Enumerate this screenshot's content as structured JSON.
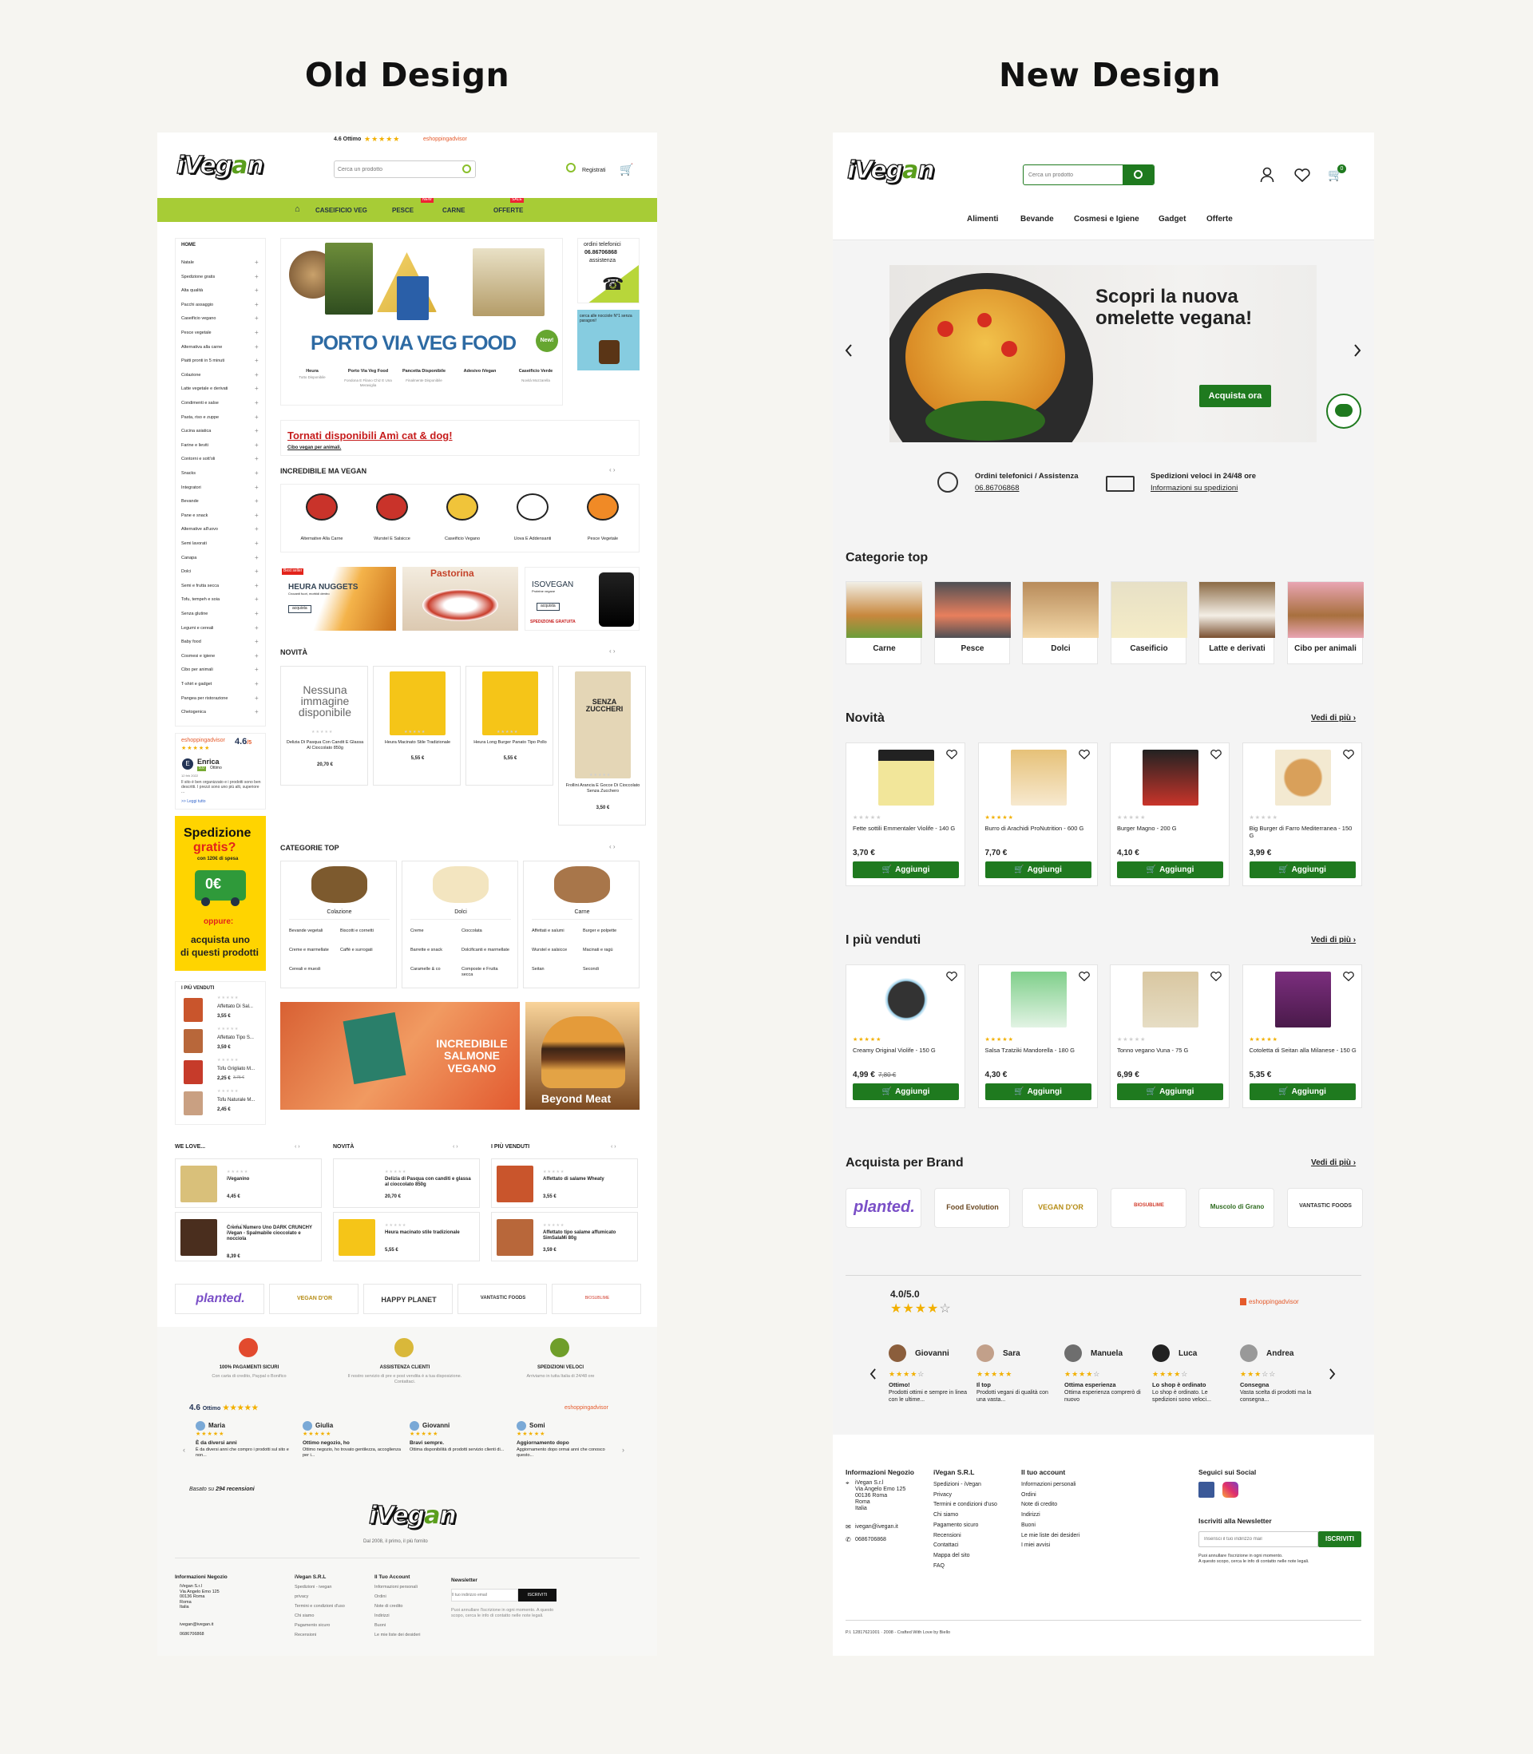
{
  "headings": {
    "old": "Old Design",
    "new": "New Design"
  },
  "old": {
    "topbar": {
      "score": "4.6 Ottimo",
      "advisor": "eshoppingadvisor"
    },
    "logo": {
      "pre": "iVeg",
      "mid": "a",
      "post": "n"
    },
    "search": {
      "placeholder": "Cerca un prodotto"
    },
    "register": "Registrati",
    "nav": {
      "items": [
        "CASEIFICIO VEG",
        "PESCE",
        "CARNE",
        "OFFERTE"
      ],
      "badges": [
        "NEW",
        "SALE"
      ]
    },
    "sidebar": {
      "home": "HOME",
      "items": [
        "Natale",
        "Spedizione gratis",
        "Alta qualità",
        "Pacchi assaggio",
        "Caseificio vegano",
        "Pesce vegetale",
        "Alternativa alla carne",
        "Piatti pronti in 5 minuti",
        "Colazione",
        "Latte vegetale e derivati",
        "Condimenti e salse",
        "Pasta, riso e zuppe",
        "Cucina asiatica",
        "Farine e lieviti",
        "Contorni e sott'oli",
        "Snacks",
        "Integratori",
        "Bevande",
        "Pane e snack",
        "Alternative all'uovo",
        "Semi lavorati",
        "Canapa",
        "Dolci",
        "Semi e frutta secca",
        "Tofu, tempeh e soia",
        "Senza glutine",
        "Legumi e cereali",
        "Baby food",
        "Cosmesi e igiene",
        "Cibo per animali",
        "T-shirt e gadget",
        "Pangea per ristorazione",
        "Chetogenica"
      ]
    },
    "sidereview": {
      "brand": "eshoppingadvisor",
      "score": "4.6",
      "outof": "/5",
      "name": "Enrica",
      "rating": "5.0",
      "label": "Ottimo",
      "date": "12 feb 2022",
      "text": "Il sito è ben organizzato e i prodotti sono ben descritti. I prezzi sono uno più alti, superiore ...",
      "more": ">> Leggi tutto"
    },
    "promo": {
      "title1": "Spedizione",
      "title2": "gratis?",
      "sub": "con 120€ di spesa",
      "price": "0€",
      "or": "oppure:",
      "cta1": "acquista uno",
      "cta2": "di questi prodotti"
    },
    "bestside": {
      "title": "I PIÙ VENDUTI",
      "items": [
        {
          "name": "Affettato Di Sal...",
          "price": "3,55 €"
        },
        {
          "name": "Affettato Tipo S...",
          "price": "3,59 €"
        },
        {
          "name": "Tofu Grigliato M...",
          "price": "2,25 €",
          "old": "3,75 €"
        },
        {
          "name": "Tofu Naturale M...",
          "price": "2,45 €"
        }
      ]
    },
    "hero": {
      "title": "PORTO VIA VEG FOOD",
      "badge": "New!",
      "tabs": [
        {
          "t": "Heura",
          "s": "Tutto Disponibile"
        },
        {
          "t": "Porto Via Veg Food",
          "s": "Fondona E Filano Chiz E Una Meraviglia"
        },
        {
          "t": "Pancetta Disponibile",
          "s": "Finalmente Disponibile"
        },
        {
          "t": "Adesivo iVegan",
          "s": ""
        },
        {
          "t": "Caseificio Verde",
          "s": "Novità Mozzarella"
        }
      ]
    },
    "phone": {
      "line1": "ordini telefonici",
      "line2": "06.86706868",
      "line3": "assistenza"
    },
    "nocciole": "cerca alle nocciole N°1 senza paragoni!",
    "notice": {
      "title": "Tornati disponibili Amì cat & dog!",
      "sub": "Cibo vegan per animali."
    },
    "incredible": {
      "title": "INCREDIBILE MA VEGAN",
      "items": [
        "Alternative Alla Carne",
        "Wurstel E Salsicce",
        "Caseificio Vegano",
        "Uova E Addensanti",
        "Pesce Vegetale"
      ]
    },
    "banners": {
      "b1": "Best seller",
      "b1t": "HEURA NUGGETS",
      "b1s": "Crocanti fuori, morbidi dentro",
      "b1btn": "acquista",
      "b2": "Pastorina",
      "b3t": "ISOVEGAN",
      "b3s": "Proteine vegane",
      "b3btn": "acquista",
      "b3f": "SPEDIZIONE GRATUITA"
    },
    "novita": {
      "title": "NOVITÀ",
      "items": [
        {
          "name": "Delizia Di Pasqua Con Candit E Glassa Al Cioccolato 850g",
          "price": "20,70 €",
          "noimg": "Nessuna immagine disponibile"
        },
        {
          "name": "Heura Macinato Stile Tradizionale",
          "price": "5,55 €"
        },
        {
          "name": "Heura Long Burger Panato Tipo Pollo",
          "price": "5,55 €"
        },
        {
          "name": "Frollini Arancia E Gocce Di Cioccolato Senza Zucchero",
          "price": "3,50 €",
          "pack": "SENZA ZUCCHERI"
        }
      ]
    },
    "cattop": {
      "title": "CATEGORIE TOP",
      "cats": [
        {
          "name": "Colazione",
          "subs": [
            "Bevande vegetali",
            "Biscotti e cornetti",
            "Creme e marmellate",
            "Caffè e surrogati",
            "Cereali e muesli"
          ]
        },
        {
          "name": "Dolci",
          "subs": [
            "Creme",
            "Cioccolata",
            "Barrette e snack",
            "Dolcificanti e marmellate",
            "Caramelle & co",
            "Composte e Frutta secca"
          ]
        },
        {
          "name": "Carne",
          "subs": [
            "Affettati e salumi",
            "Burger e polpette",
            "Wurstel e salsicce",
            "Macinati e ragù",
            "Seitan",
            "Secondi"
          ]
        }
      ]
    },
    "big": {
      "salmone": "INCREDIBILE SALMONE VEGANO",
      "beyond": "Beyond Meat"
    },
    "welove": {
      "title": "WE LOVE...",
      "items": [
        {
          "name": "iVeganino",
          "price": "4,45 €"
        },
        {
          "name": "Crema Numero Uno DARK CRUNCHY iVegan - Spalmabile cioccolato e nocciola",
          "price": "8,39 €"
        }
      ]
    },
    "novita2": {
      "title": "NOVITÀ",
      "items": [
        {
          "name": "Delizia di Pasqua con canditi e glassa al cioccolato 850g",
          "price": "20,70 €"
        },
        {
          "name": "Heura macinato stile tradizionale",
          "price": "5,55 €"
        }
      ]
    },
    "best2": {
      "title": "I PIÙ VENDUTI",
      "items": [
        {
          "name": "Affettato di salame Wheaty",
          "price": "3,55 €"
        },
        {
          "name": "Affettato tipo salame affumicato SimSalaMi 80g",
          "price": "3,59 €"
        }
      ]
    },
    "brands": [
      "planted.",
      "VEGAN D'OR",
      "HAPPY PLANET",
      "VANTASTIC FOODS",
      "BIOSUBLIME"
    ],
    "features": [
      {
        "t": "100% PAGAMENTI SICURI",
        "s": "Con carta di credito, Paypal o Bonifico"
      },
      {
        "t": "ASSISTENZA CLIENTI",
        "s": "Il nostro servizio di pre e post vendita è a tua disposizione. Contattaci."
      },
      {
        "t": "SPEDIZIONI VELOCI",
        "s": "Arriviamo in tutta Italia di 24/48 ore"
      }
    ],
    "reviews": {
      "score": "4.6",
      "label": "Ottimo",
      "brand": "eshoppingadvisor",
      "items": [
        {
          "n": "Maria",
          "t": "È da diversi anni",
          "x": "È da diversi anni che compro i prodotti sul sito e non..."
        },
        {
          "n": "Giulia",
          "t": "Ottimo negozio, ho",
          "x": "Ottimo negozio, ho trovato gentilezza, accoglienza per i..."
        },
        {
          "n": "Giovanni",
          "t": "Bravi sempre.",
          "x": "Ottima disponibilità di prodotti servizio clienti di..."
        },
        {
          "n": "Somi",
          "t": "Aggiornamento dopo",
          "x": "Aggiornamento dopo ormai anni che conosco questo..."
        }
      ],
      "basedon": "Basato su",
      "count": "294 recensioni"
    },
    "footer": {
      "tagline": "Dal 2008, il primo, il più fornito",
      "info": {
        "h": "Informazioni Negozio",
        "lines": [
          "iVegan S.r.l",
          "Via Angelo Emo 125",
          "00136 Roma",
          "Roma",
          "Italia"
        ],
        "email": "ivegan@ivegan.it",
        "phone": "0686706868"
      },
      "c2": {
        "h": "iVegan S.R.L",
        "items": [
          "Spedizioni - ivegan",
          "privacy",
          "Termini e condizioni d'uso",
          "Chi siamo",
          "Pagamento sicuro",
          "Recensioni"
        ]
      },
      "c3": {
        "h": "Il Tuo Account",
        "items": [
          "Informazioni personali",
          "Ordini",
          "Note di credito",
          "Indirizzi",
          "Buoni",
          "Le mie liste dei desideri"
        ]
      },
      "c4": {
        "h": "Newsletter",
        "placeholder": "Il tuo indirizzo email",
        "btn": "ISCRIVITI",
        "note": "Puoi annullare l'iscrizione in ogni momento. A questo scopo, cerca le info di contatto nelle note legali."
      }
    }
  },
  "new": {
    "logo": {
      "pre": "iVeg",
      "mid": "a",
      "post": "n"
    },
    "search": {
      "placeholder": "Cerca un prodotto"
    },
    "cart_count": "0",
    "nav": [
      "Alimenti",
      "Bevande",
      "Cosmesi e Igiene",
      "Gadget",
      "Offerte"
    ],
    "hero": {
      "title1": "Scopri la nuova",
      "title2": "omelette vegana!",
      "cta": "Acquista ora"
    },
    "info": [
      {
        "t": "Ordini telefonici / Assistenza",
        "l": "06.86706868"
      },
      {
        "t": "Spedizioni veloci in 24/48 ore",
        "l": "Informazioni su spedizioni"
      }
    ],
    "cattop": {
      "title": "Categorie top",
      "items": [
        "Carne",
        "Pesce",
        "Dolci",
        "Caseificio",
        "Latte e derivati",
        "Cibo per animali"
      ]
    },
    "more": "Vedi di più",
    "add": "Aggiungi",
    "novita": {
      "title": "Novità",
      "items": [
        {
          "name": "Fette sottili Emmentaler Violife - 140 G",
          "price": "3,70 €",
          "stars": 0
        },
        {
          "name": "Burro di Arachidi ProNutrition - 600 G",
          "price": "7,70 €",
          "stars": 5
        },
        {
          "name": "Burger Magno - 200 G",
          "price": "4,10 €",
          "stars": 0
        },
        {
          "name": "Big Burger di Farro Mediterranea - 150 G",
          "price": "3,99 €",
          "stars": 0
        }
      ]
    },
    "best": {
      "title": "I più venduti",
      "items": [
        {
          "name": "Creamy Original Violife - 150 G",
          "price": "4,99 €",
          "old": "7,80 €",
          "stars": 5
        },
        {
          "name": "Salsa Tzatziki Mandorella - 180 G",
          "price": "4,30 €",
          "stars": 5
        },
        {
          "name": "Tonno vegano Vuna - 75 G",
          "price": "6,99 €",
          "stars": 0
        },
        {
          "name": "Cotoletta di Seitan alla Milanese - 150 G",
          "price": "5,35 €",
          "stars": 5
        }
      ]
    },
    "brands": {
      "title": "Acquista per Brand",
      "items": [
        "planted.",
        "Food Evolution",
        "VEGAN D'OR",
        "BIOSUBLIME",
        "Muscolo di Grano",
        "VANTASTIC FOODS"
      ]
    },
    "reviews": {
      "score": "4.0/5.0",
      "brand": "eshoppingadvisor",
      "items": [
        {
          "n": "Giovanni",
          "t": "Ottimo!",
          "x": "Prodotti ottimi e sempre in linea con le ultime..."
        },
        {
          "n": "Sara",
          "t": "Il top",
          "x": "Prodotti vegani di qualità con una vasta..."
        },
        {
          "n": "Manuela",
          "t": "Ottima esperienza",
          "x": "Ottima esperienza comprerò di nuovo"
        },
        {
          "n": "Luca",
          "t": "Lo shop è ordinato",
          "x": "Lo shop è ordinato. Le spedizioni sono veloci..."
        },
        {
          "n": "Andrea",
          "t": "Consegna",
          "x": "Vasta scelta di prodotti ma la consegna..."
        }
      ]
    },
    "footer": {
      "info": {
        "h": "Informazioni Negozio",
        "lines": [
          "iVegan S.r.l",
          "Via Angelo Emo 125",
          "00136 Roma",
          "Roma",
          "Italia"
        ],
        "email": "ivegan@ivegan.it",
        "phone": "0686706868"
      },
      "c2": {
        "h": "iVegan S.R.L",
        "items": [
          "Spedizioni - iVegan",
          "Privacy",
          "Termini e condizioni d'uso",
          "Chi siamo",
          "Pagamento sicuro",
          "Recensioni",
          "Contattaci",
          "Mappa del sito",
          "FAQ"
        ]
      },
      "c3": {
        "h": "Il tuo account",
        "items": [
          "Informazioni personali",
          "Ordini",
          "Note di credito",
          "Indirizzi",
          "Buoni",
          "Le mie liste dei desideri",
          "I miei avvisi"
        ]
      },
      "social": {
        "h": "Seguici sui Social"
      },
      "news": {
        "h": "Iscriviti alla Newsletter",
        "placeholder": "Inserisci il tuo indirizzo mail",
        "btn": "ISCRIVITI",
        "note1": "Puoi annullare l'iscrizione in ogni momento.",
        "note2": "A questo scopo, cerca le info di contatto nelle note legali."
      },
      "legal": "P.I. 12817621001 · 2008 - Crafted With Love by Biello"
    }
  }
}
